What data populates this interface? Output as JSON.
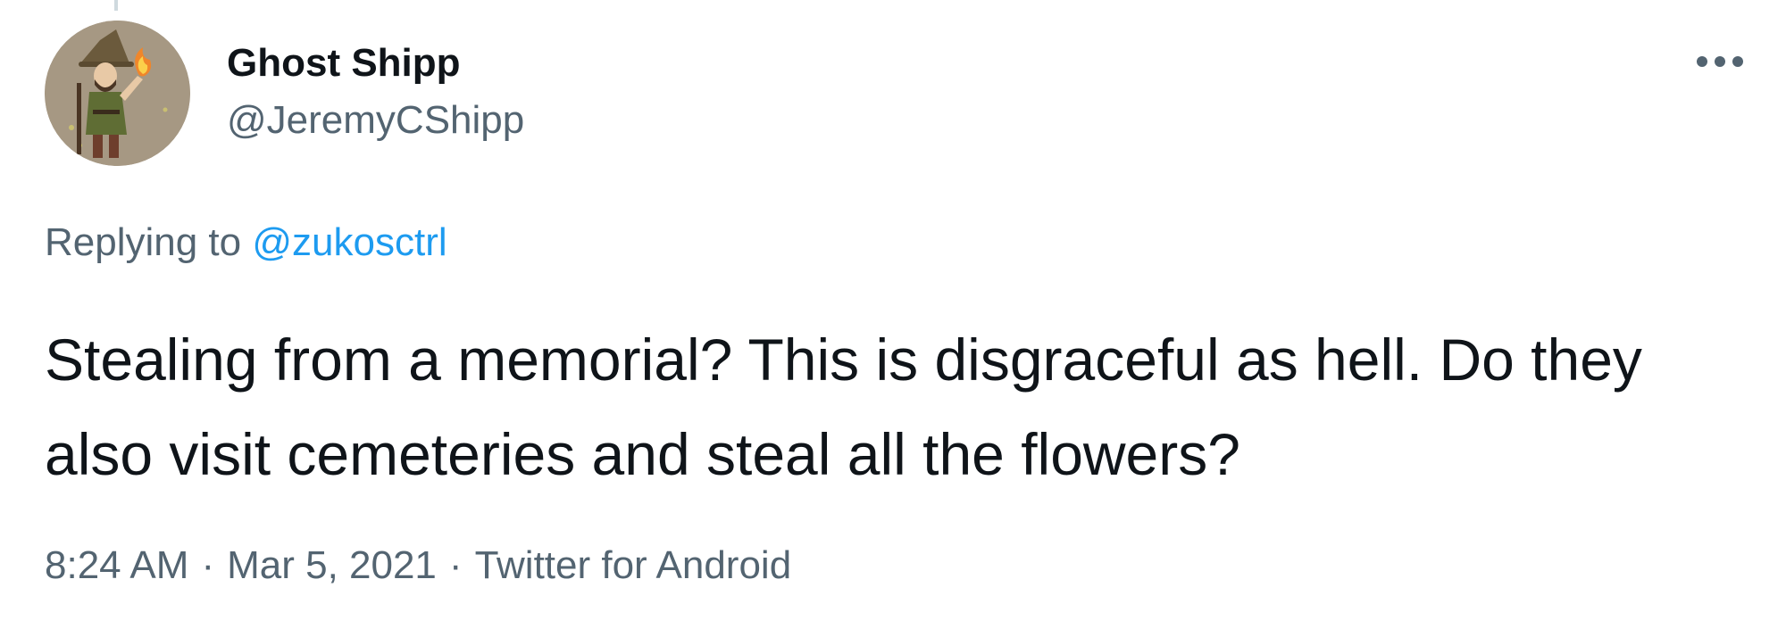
{
  "tweet": {
    "author": {
      "name": "Ghost Shipp",
      "handle": "@JeremyCShipp"
    },
    "more_icon": "more-horizontal-icon",
    "reply": {
      "prefix": "Replying to",
      "mention": "@zukosctrl"
    },
    "text": "Stealing from a memorial? This is disgraceful as hell. Do they also visit cemeteries and steal all the flowers?",
    "meta": {
      "time": "8:24 AM",
      "separator": "·",
      "date": "Mar 5, 2021",
      "source": "Twitter for Android"
    }
  },
  "colors": {
    "text_primary": "#0f1419",
    "text_secondary": "#536471",
    "link": "#1d9bf0",
    "thread_line": "#cfd9de"
  }
}
